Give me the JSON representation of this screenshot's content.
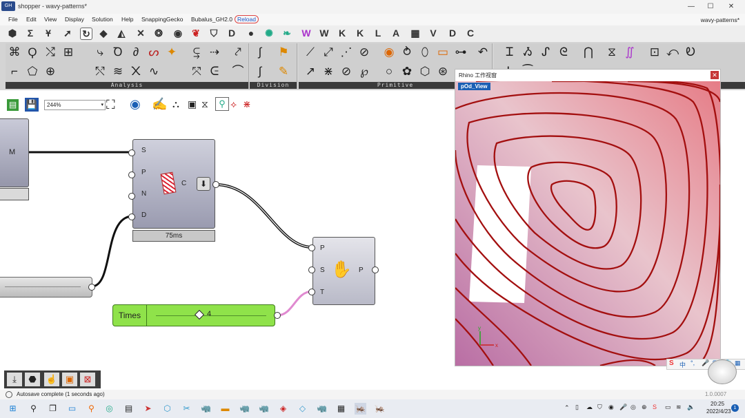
{
  "window": {
    "title": "shopper - wavy-patterns*",
    "logo_text": "GH",
    "document_title": "wavy-patterns*",
    "buttons": {
      "minimize": "—",
      "maximize": "☐",
      "close": "✕"
    }
  },
  "menu": {
    "items": [
      "File",
      "Edit",
      "View",
      "Display",
      "Solution",
      "Help",
      "SnappingGecko",
      "Bubalus_GH2.0",
      "Reload"
    ]
  },
  "plugin_tabs": {
    "text_tabs": [
      "W",
      "K",
      "K",
      "L",
      "A",
      "V",
      "D",
      "C"
    ]
  },
  "ribbon": {
    "panels": [
      {
        "label": "Analysis"
      },
      {
        "label": "Division"
      },
      {
        "label": "Primitive"
      }
    ],
    "expand_glyph": "+"
  },
  "canvas_toolbar": {
    "zoom": "244%"
  },
  "canvas": {
    "left_node_label": "M",
    "main_node": {
      "inputs": [
        "S",
        "P",
        "N",
        "D"
      ],
      "output": "C",
      "time": "75ms"
    },
    "second_node": {
      "inputs": [
        "P",
        "S",
        "T"
      ],
      "output": "P"
    },
    "slider": {
      "name": "Times",
      "value": "4"
    }
  },
  "viewport": {
    "window_title": "Rhino 工作视窗",
    "tab_label": "pOd_View",
    "close_glyph": "✕",
    "axis_x": "x",
    "axis_y": "y",
    "tray": {
      "ime": "中"
    }
  },
  "status": {
    "message": "Autosave complete (1 seconds ago)",
    "version": "1.0.0007"
  },
  "taskbar": {
    "time": "20:25",
    "date": "2022/4/23",
    "notification_count": "1"
  },
  "colors": {
    "wire": "#111111",
    "slider_green": "#8fe24a",
    "curve_red": "#a30f0f",
    "accent_blue": "#1a5fb4"
  }
}
